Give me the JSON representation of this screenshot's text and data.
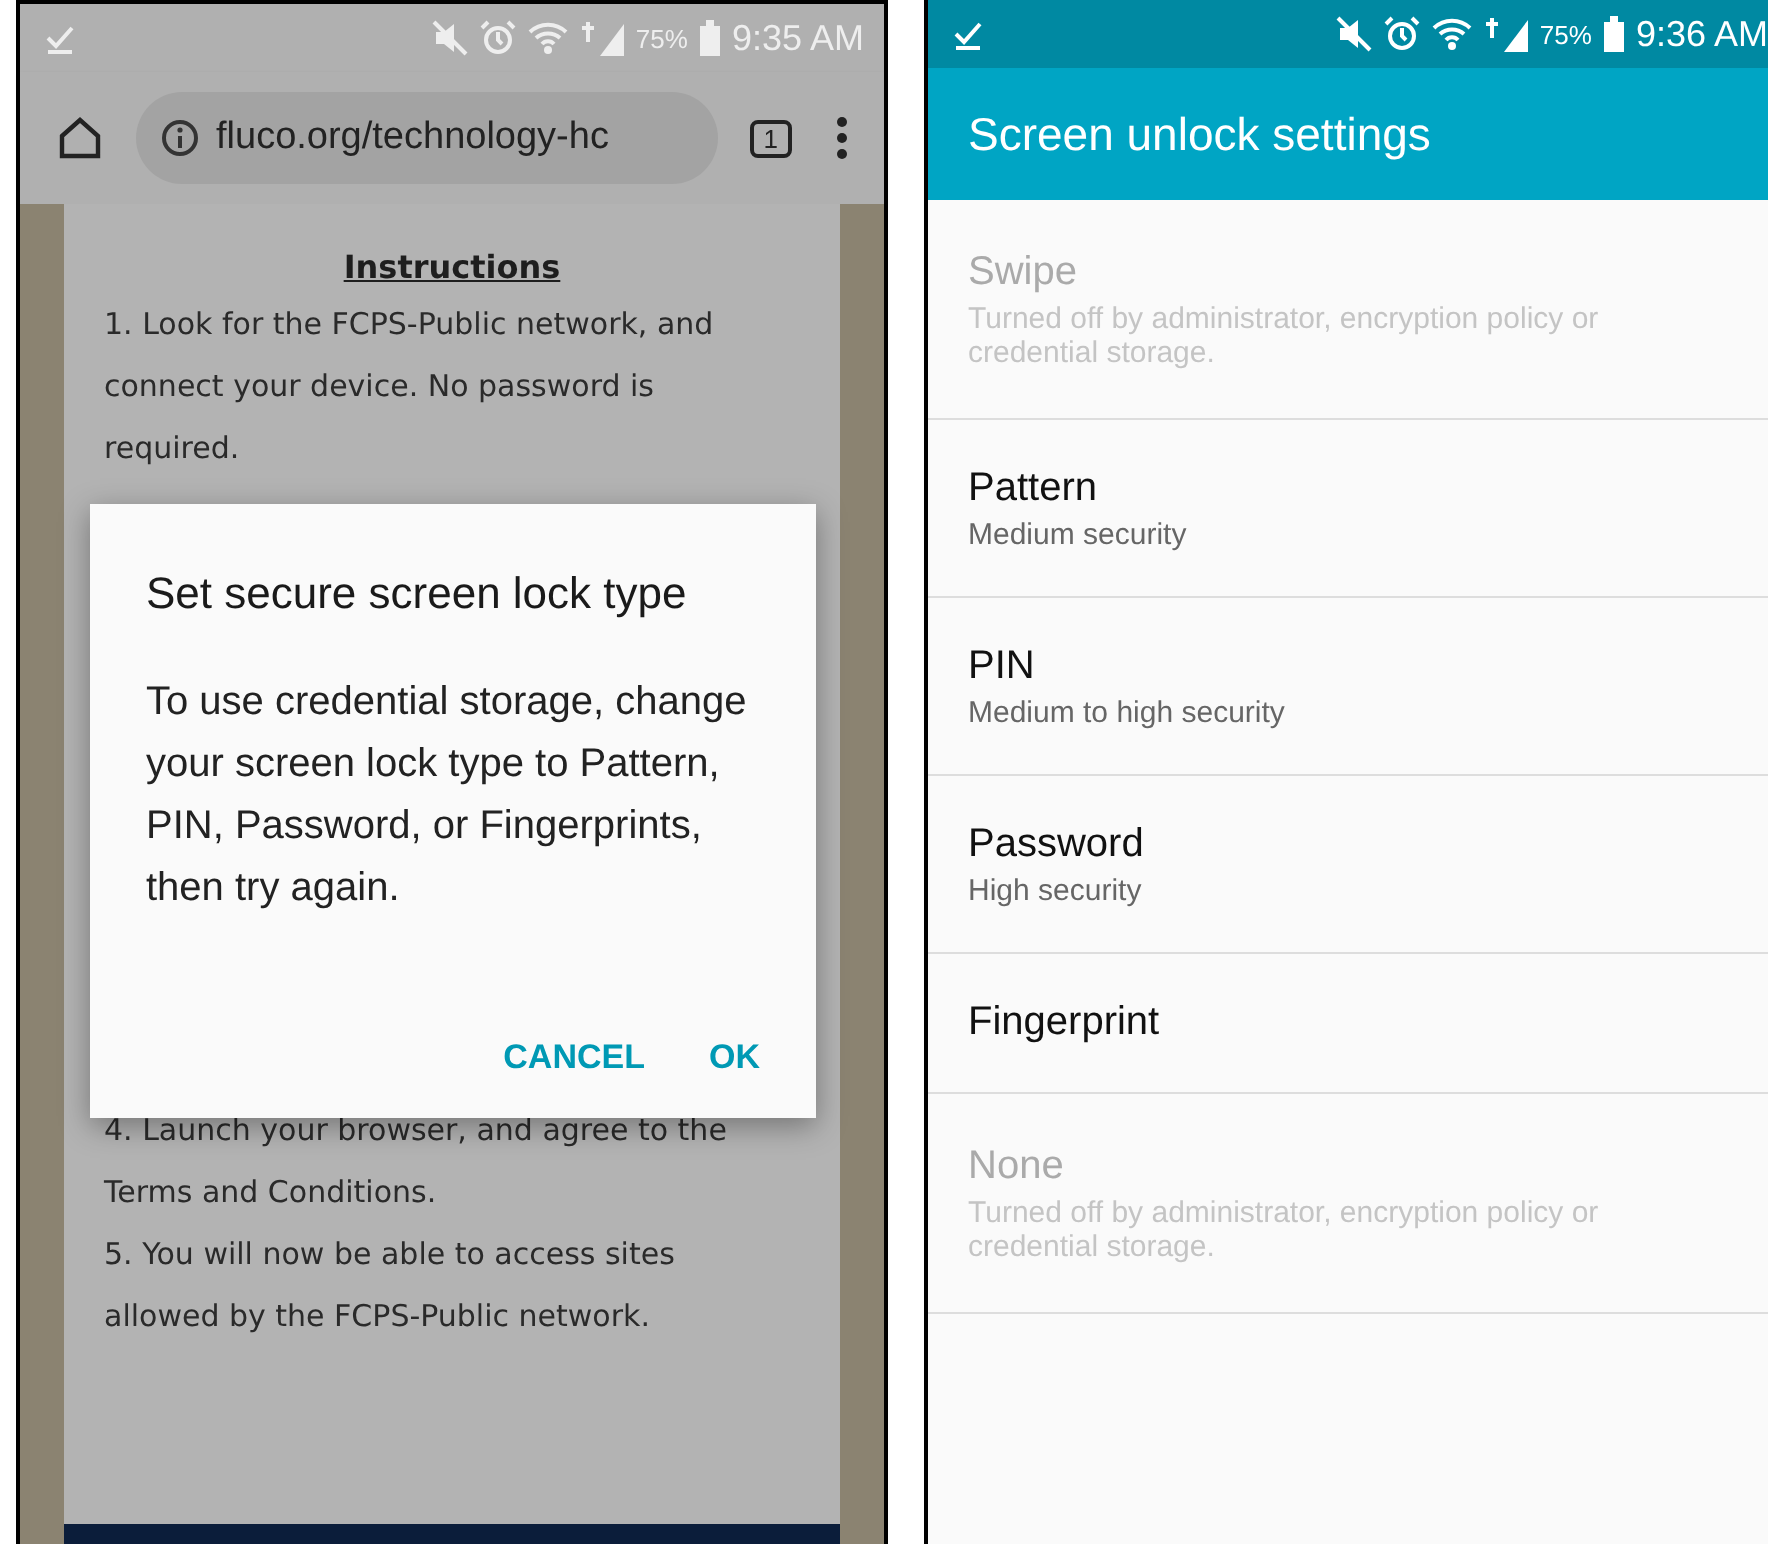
{
  "phones": [
    {
      "kind": "browser",
      "status_bar": {
        "battery": "75%",
        "time": "9:35 AM"
      },
      "browser": {
        "url": "fluco.org/technology-hᴄ",
        "tab_count": "1"
      },
      "page": {
        "heading": "Instructions",
        "lines_above": [
          "1. Look for the FCPS-Public network, and",
          "connect your device. No password is",
          "required."
        ],
        "lines_below": [
          "4. Launch your browser, and agree to the",
          "Terms and Conditions.",
          "5. You will now be able to access sites",
          "allowed by the FCPS-Public network."
        ]
      },
      "dialog": {
        "title": "Set secure screen lock type",
        "message": "To use credential storage, change your screen lock type to Pattern, PIN, Password, or Fingerprints, then try again.",
        "buttons": [
          "CANCEL",
          "OK"
        ]
      }
    },
    {
      "kind": "settings",
      "status_bar": {
        "battery": "75%",
        "time": "9:36 AM"
      },
      "title": "Screen unlock settings",
      "items": [
        {
          "label": "Swipe",
          "summary": "Turned off by administrator, encryption policy or credential storage.",
          "disabled": true
        },
        {
          "label": "Pattern",
          "summary": "Medium security",
          "disabled": false
        },
        {
          "label": "PIN",
          "summary": "Medium to high security",
          "disabled": false
        },
        {
          "label": "Password",
          "summary": "High security",
          "disabled": false
        },
        {
          "label": "Fingerprint",
          "disabled": false
        },
        {
          "label": "None",
          "summary": "Turned off by administrator, encryption policy or credential storage.",
          "disabled": true
        }
      ]
    }
  ]
}
